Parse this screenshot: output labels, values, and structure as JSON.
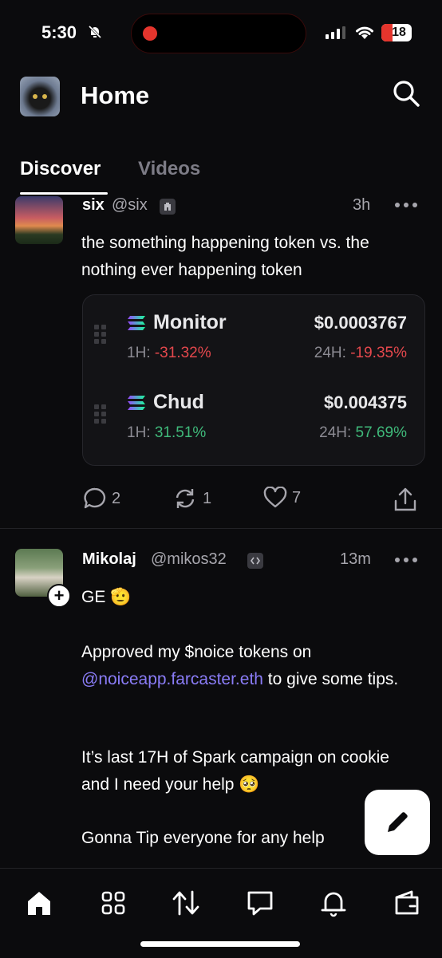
{
  "status_bar": {
    "time": "5:30",
    "battery": "18"
  },
  "header": {
    "title": "Home"
  },
  "tabs": [
    {
      "label": "Discover",
      "active": true
    },
    {
      "label": "Videos",
      "active": false
    }
  ],
  "posts": [
    {
      "author": "six",
      "handle": "@six",
      "time": "3h",
      "text": "the something happening token vs. the nothing ever happening token",
      "tokens": [
        {
          "name": "Monitor",
          "price": "$0.0003767",
          "h1_label": "1H:",
          "h1": "-31.32%",
          "h24_label": "24H:",
          "h24": "-19.35%"
        },
        {
          "name": "Chud",
          "price": "$0.004375",
          "h1_label": "1H:",
          "h1": "31.51%",
          "h24_label": "24H:",
          "h24": "57.69%"
        }
      ],
      "actions": {
        "replies": "2",
        "recasts": "1",
        "likes": "7"
      }
    },
    {
      "author": "Mikolaj",
      "handle": "@mikos32",
      "time": "13m",
      "text_1": "GE 🫡",
      "text_2a": "Approved my $noice tokens on ",
      "mention": "@noiceapp.farcaster.eth",
      "text_2b": " to give some tips.",
      "text_3": "It’s last 17H of Spark campaign on cookie and I need your help 🥺",
      "text_4": "Gonna Tip everyone for any help"
    }
  ],
  "colors": {
    "negative": "#e5484d",
    "positive": "#3fb97a",
    "mention": "#8a7cf6",
    "background": "#0b0b0d"
  },
  "icons": [
    "search-icon",
    "more-icon",
    "reply-icon",
    "recast-icon",
    "like-icon",
    "share-icon",
    "compose-icon",
    "home-icon",
    "apps-icon",
    "swap-icon",
    "messages-icon",
    "notifications-icon",
    "wallet-icon"
  ]
}
